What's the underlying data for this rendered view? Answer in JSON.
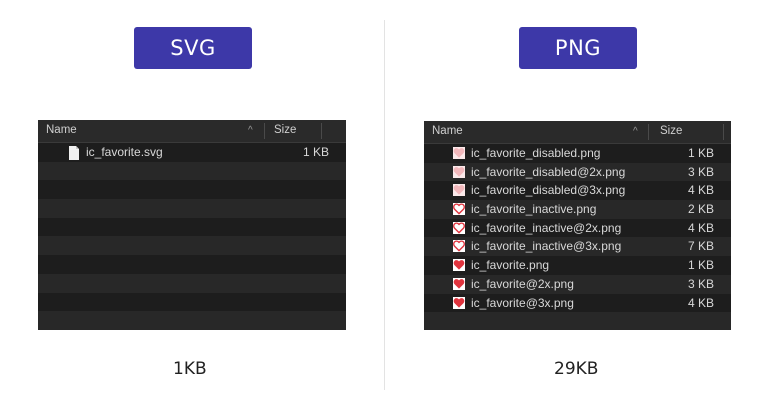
{
  "svg_side": {
    "badge": "SVG",
    "columns": {
      "name": "Name",
      "size": "Size"
    },
    "files": [
      {
        "name": "ic_favorite.svg",
        "size": "1 KB",
        "icon": "document-icon"
      }
    ],
    "total": "1KB"
  },
  "png_side": {
    "badge": "PNG",
    "columns": {
      "name": "Name",
      "size": "Size"
    },
    "files": [
      {
        "name": "ic_favorite_disabled.png",
        "size": "1 KB",
        "icon": "heart-disabled-icon"
      },
      {
        "name": "ic_favorite_disabled@2x.png",
        "size": "3 KB",
        "icon": "heart-disabled-icon"
      },
      {
        "name": "ic_favorite_disabled@3x.png",
        "size": "4 KB",
        "icon": "heart-disabled-icon"
      },
      {
        "name": "ic_favorite_inactive.png",
        "size": "2 KB",
        "icon": "heart-outline-icon"
      },
      {
        "name": "ic_favorite_inactive@2x.png",
        "size": "4 KB",
        "icon": "heart-outline-icon"
      },
      {
        "name": "ic_favorite_inactive@3x.png",
        "size": "7 KB",
        "icon": "heart-outline-icon"
      },
      {
        "name": "ic_favorite.png",
        "size": "1 KB",
        "icon": "heart-filled-icon"
      },
      {
        "name": "ic_favorite@2x.png",
        "size": "3 KB",
        "icon": "heart-filled-icon"
      },
      {
        "name": "ic_favorite@3x.png",
        "size": "4 KB",
        "icon": "heart-filled-icon"
      }
    ],
    "total": "29KB"
  },
  "colors": {
    "badge": "#3d38a8",
    "panel_bg": "#1d1d1d",
    "row_alt": "#282828",
    "heart": "#e0343e",
    "heart_disabled": "#f2b8bc"
  }
}
